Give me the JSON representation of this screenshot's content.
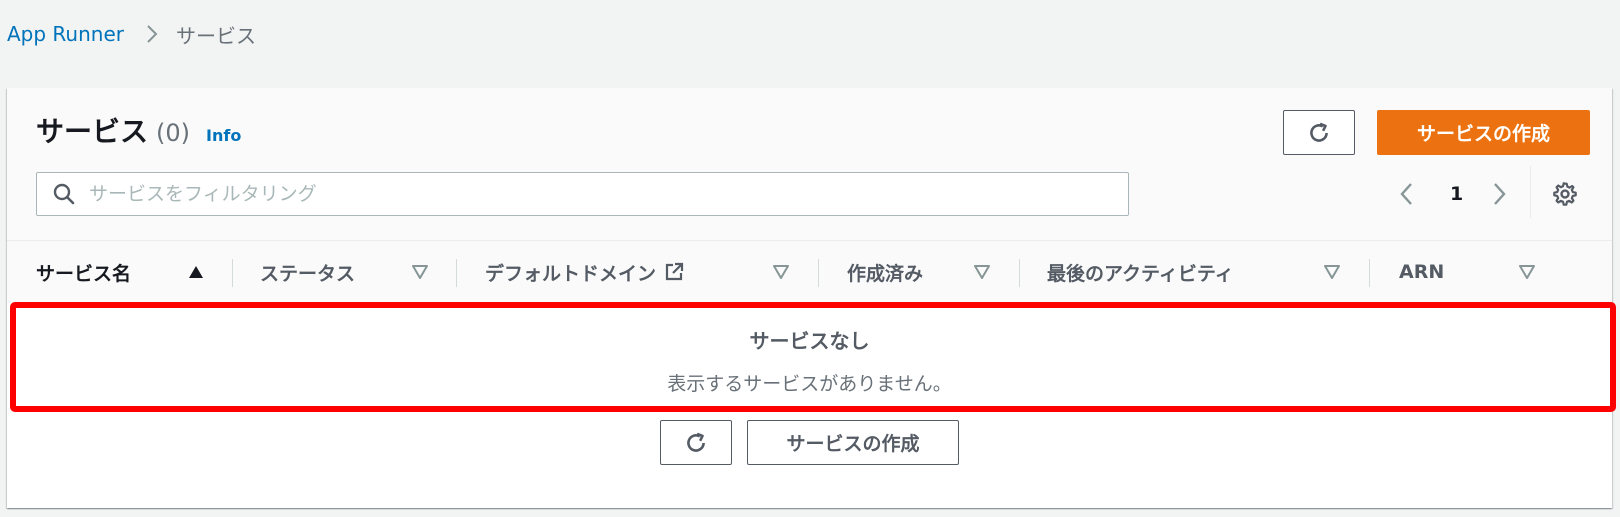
{
  "breadcrumb": {
    "root": "App Runner",
    "current": "サービス"
  },
  "header": {
    "title": "サービス",
    "count": "(0)",
    "info_label": "Info",
    "create_button": "サービスの作成"
  },
  "search": {
    "placeholder": "サービスをフィルタリング",
    "value": ""
  },
  "pagination": {
    "current_page": "1"
  },
  "table": {
    "columns": [
      {
        "label": "サービス名",
        "sort": "ascending"
      },
      {
        "label": "ステータス",
        "sort": "none"
      },
      {
        "label": "デフォルトドメイン",
        "sort": "none",
        "icon": "external-link-icon"
      },
      {
        "label": "作成済み",
        "sort": "none"
      },
      {
        "label": "最後のアクティビティ",
        "sort": "none"
      },
      {
        "label": "ARN",
        "sort": "none"
      }
    ]
  },
  "empty_state": {
    "title": "サービスなし",
    "description": "表示するサービスがありません。",
    "create_button": "サービスの作成"
  },
  "colors": {
    "primary": "#ec7211",
    "link": "#0073bb",
    "highlight": "#ff0000"
  }
}
